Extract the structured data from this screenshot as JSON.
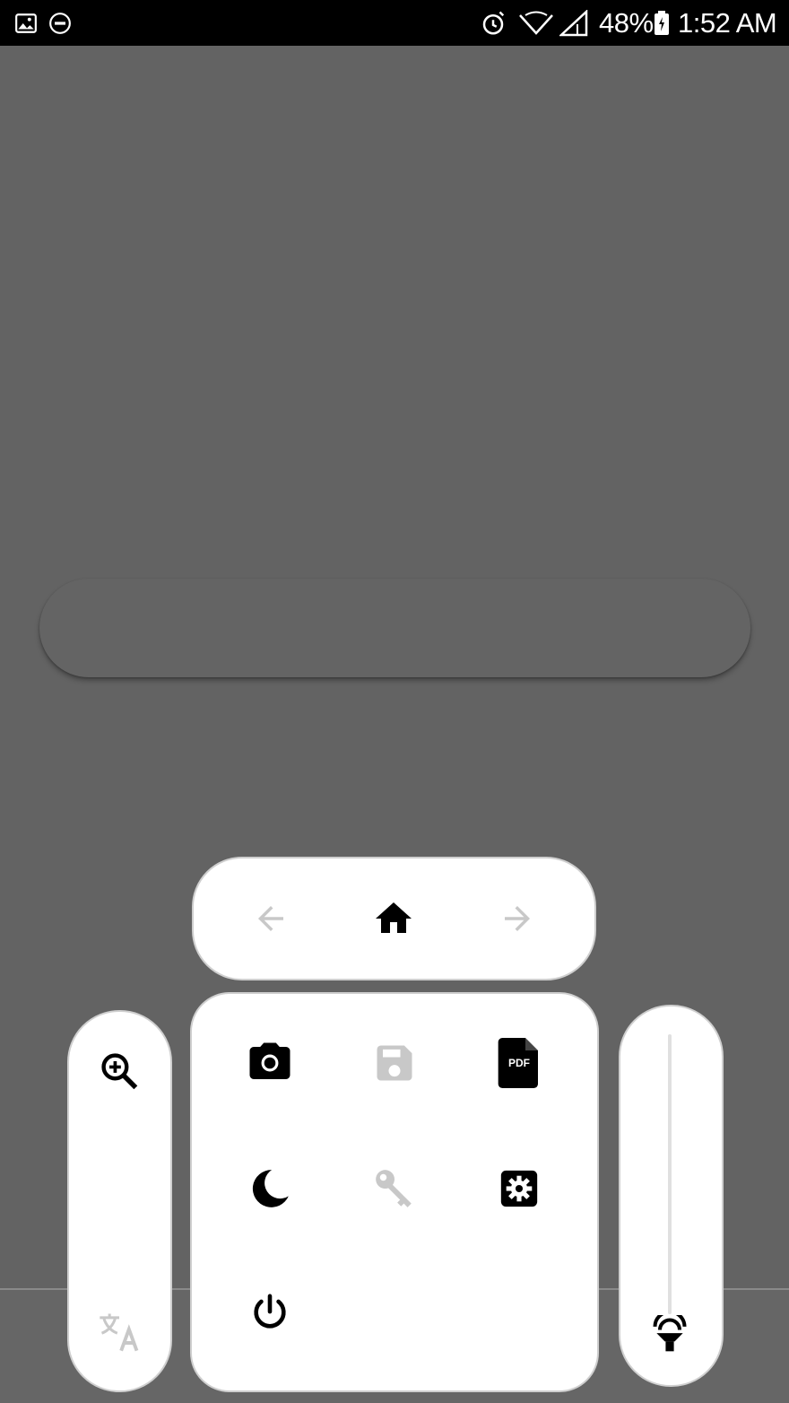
{
  "status_bar": {
    "battery_percent": "48%",
    "time": "1:52 AM",
    "left_icons": [
      "image-icon",
      "do-not-disturb-icon"
    ],
    "right_icons": [
      "alarm-icon",
      "wifi-icon",
      "signal-icon",
      "battery-icon"
    ]
  },
  "search": {
    "placeholder": ""
  },
  "nav_panel": {
    "items": [
      {
        "icon": "arrow-back-icon",
        "enabled": false
      },
      {
        "icon": "home-icon",
        "enabled": true
      },
      {
        "icon": "arrow-forward-icon",
        "enabled": false
      }
    ]
  },
  "grid_panel": {
    "items": [
      {
        "icon": "camera-icon",
        "enabled": true
      },
      {
        "icon": "save-icon",
        "enabled": false
      },
      {
        "icon": "pdf-icon",
        "label": "PDF",
        "enabled": true
      },
      {
        "icon": "night-mode-icon",
        "enabled": true
      },
      {
        "icon": "key-icon",
        "enabled": false
      },
      {
        "icon": "settings-icon",
        "enabled": true
      },
      {
        "icon": "power-icon",
        "enabled": true
      }
    ]
  },
  "left_panel": {
    "items": [
      {
        "icon": "zoom-in-icon",
        "enabled": true
      },
      {
        "icon": "translate-icon",
        "enabled": false
      }
    ]
  },
  "right_panel": {
    "items": [
      {
        "icon": "brightness-lamp-icon",
        "enabled": true
      }
    ],
    "slider_value": 0
  },
  "colors": {
    "background": "#636363",
    "status_bar": "#000000",
    "panel": "#ffffff",
    "icon_enabled": "#000000",
    "icon_disabled": "#c8c8c8"
  }
}
